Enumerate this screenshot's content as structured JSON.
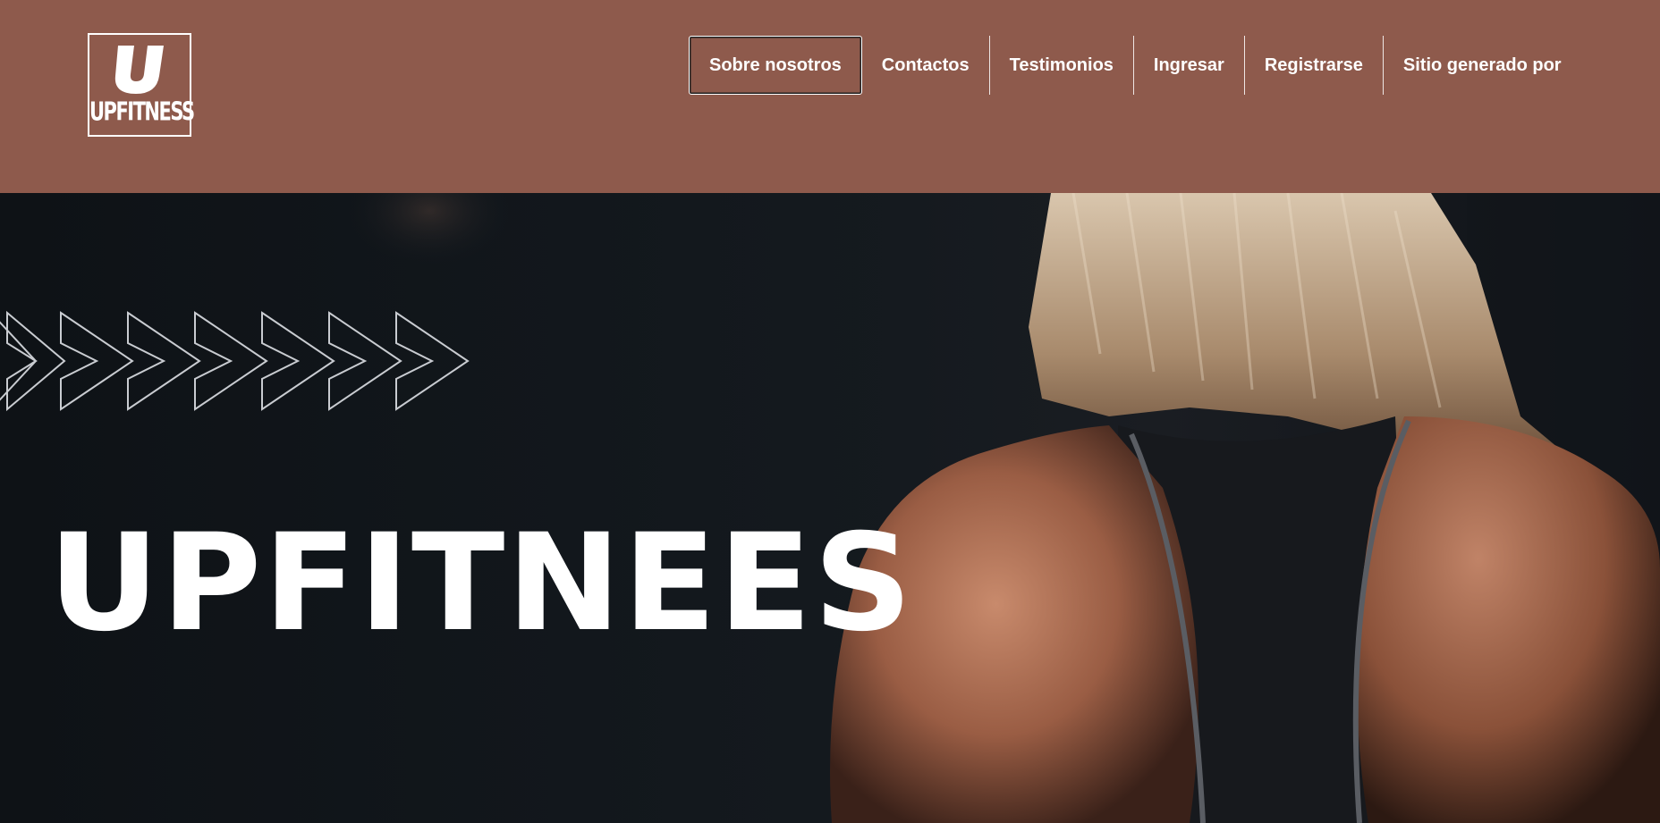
{
  "brand": {
    "logo_letter": "U",
    "logo_word": "UPFITNESS",
    "header_color": "#8e5a4c"
  },
  "nav": {
    "items": [
      {
        "label": "Sobre nosotros",
        "active": true
      },
      {
        "label": "Contactos"
      },
      {
        "label": "Testimonios"
      },
      {
        "label": "Ingresar"
      },
      {
        "label": "Registrarse"
      },
      {
        "label": "Sitio generado por"
      }
    ]
  },
  "hero": {
    "title": "UPFITNEES",
    "image_subject": "woman-back-athlete-photo",
    "decoration": "chevron-arrows-icon"
  }
}
